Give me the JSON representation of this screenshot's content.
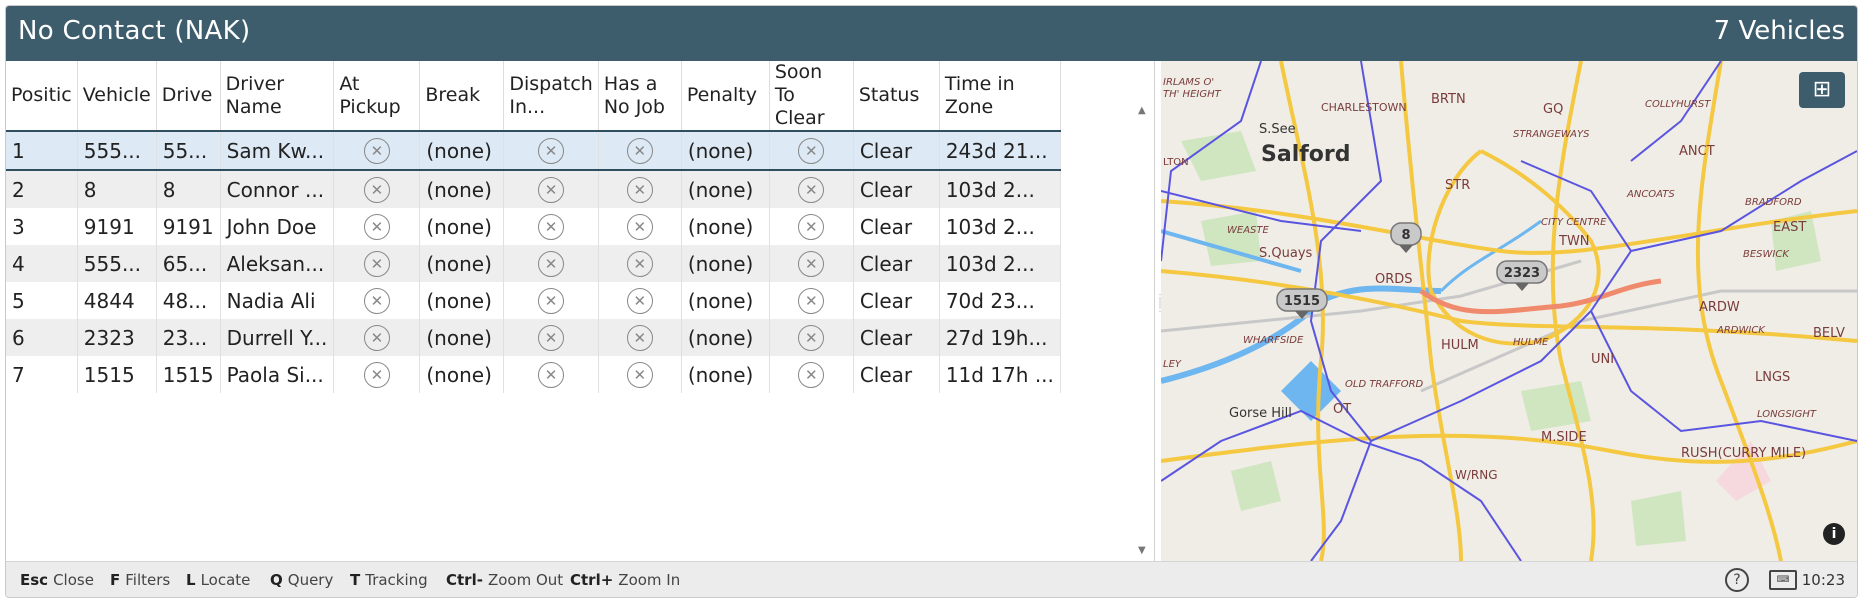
{
  "header": {
    "title": "No Contact (NAK)",
    "vehicle_count": "7 Vehicles"
  },
  "table": {
    "columns": [
      "Positic",
      "Vehicle",
      "Drive",
      "Driver Name",
      "At Pickup",
      "Break",
      "Dispatch In...",
      "Has a No Job",
      "Penalty",
      "Soon To Clear",
      "Status",
      "Time in Zone"
    ],
    "rows": [
      {
        "pos": "1",
        "vehicle": "555...",
        "driver": "55...",
        "name": "Sam Kw...",
        "break": "(none)",
        "penalty": "(none)",
        "status": "Clear",
        "time": "243d 21..."
      },
      {
        "pos": "2",
        "vehicle": "8",
        "driver": "8",
        "name": "Connor ...",
        "break": "(none)",
        "penalty": "(none)",
        "status": "Clear",
        "time": "103d 2..."
      },
      {
        "pos": "3",
        "vehicle": "9191",
        "driver": "9191",
        "name": "John Doe",
        "break": "(none)",
        "penalty": "(none)",
        "status": "Clear",
        "time": "103d 2..."
      },
      {
        "pos": "4",
        "vehicle": "555...",
        "driver": "65...",
        "name": "Aleksan...",
        "break": "(none)",
        "penalty": "(none)",
        "status": "Clear",
        "time": "103d 2..."
      },
      {
        "pos": "5",
        "vehicle": "4844",
        "driver": "48...",
        "name": "Nadia Ali",
        "break": "(none)",
        "penalty": "(none)",
        "status": "Clear",
        "time": "70d 23..."
      },
      {
        "pos": "6",
        "vehicle": "2323",
        "driver": "23...",
        "name": "Durrell Y...",
        "break": "(none)",
        "penalty": "(none)",
        "status": "Clear",
        "time": "27d 19h..."
      },
      {
        "pos": "7",
        "vehicle": "1515",
        "driver": "1515",
        "name": "Paola Si...",
        "break": "(none)",
        "penalty": "(none)",
        "status": "Clear",
        "time": "11d 17h ..."
      }
    ],
    "x_glyph": "✕"
  },
  "map": {
    "labels": [
      "IRLAMS O'",
      "TH' HEIGHT",
      "S.See",
      "Salford",
      "CHARLESTOWN",
      "BRTN",
      "GQ",
      "COLLYHURST",
      "STRANGEWAYS",
      "ANCT",
      "LTON",
      "STR",
      "ANCOATS",
      "BRADFORD",
      "WEASTE",
      "S.Quays",
      "CITY CENTRE",
      "TWN",
      "EAST",
      "BESWICK",
      "ORDS",
      "ARDW",
      "ARDWICK",
      "BELV",
      "WHARFSIDE",
      "HULM",
      "HULME",
      "UNI",
      "LNGS",
      "LEY",
      "OLD TRAFFORD",
      "Gorse Hill",
      "OT",
      "LONGSIGHT",
      "M.SIDE",
      "RUSH(CURRY MILE)",
      "W/RNG"
    ],
    "markers": [
      "8",
      "2323",
      "1515"
    ],
    "layer_icon": "grid-icon",
    "info_icon": "info-icon"
  },
  "footer": {
    "shortcuts": [
      {
        "key": "Esc",
        "label": "Close"
      },
      {
        "key": "F",
        "label": "Filters"
      },
      {
        "key": "L",
        "label": "Locate"
      },
      {
        "key": "Q",
        "label": "Query"
      },
      {
        "key": "T",
        "label": "Tracking"
      },
      {
        "key": "Ctrl-",
        "label": "Zoom Out"
      },
      {
        "key": "Ctrl+",
        "label": "Zoom In"
      }
    ],
    "help_glyph": "?",
    "time": "10:23"
  },
  "colors": {
    "header": "#3d5d6d",
    "selected_row": "#dde9f4",
    "alt_row": "#eeeeee",
    "footer": "#ececec"
  }
}
